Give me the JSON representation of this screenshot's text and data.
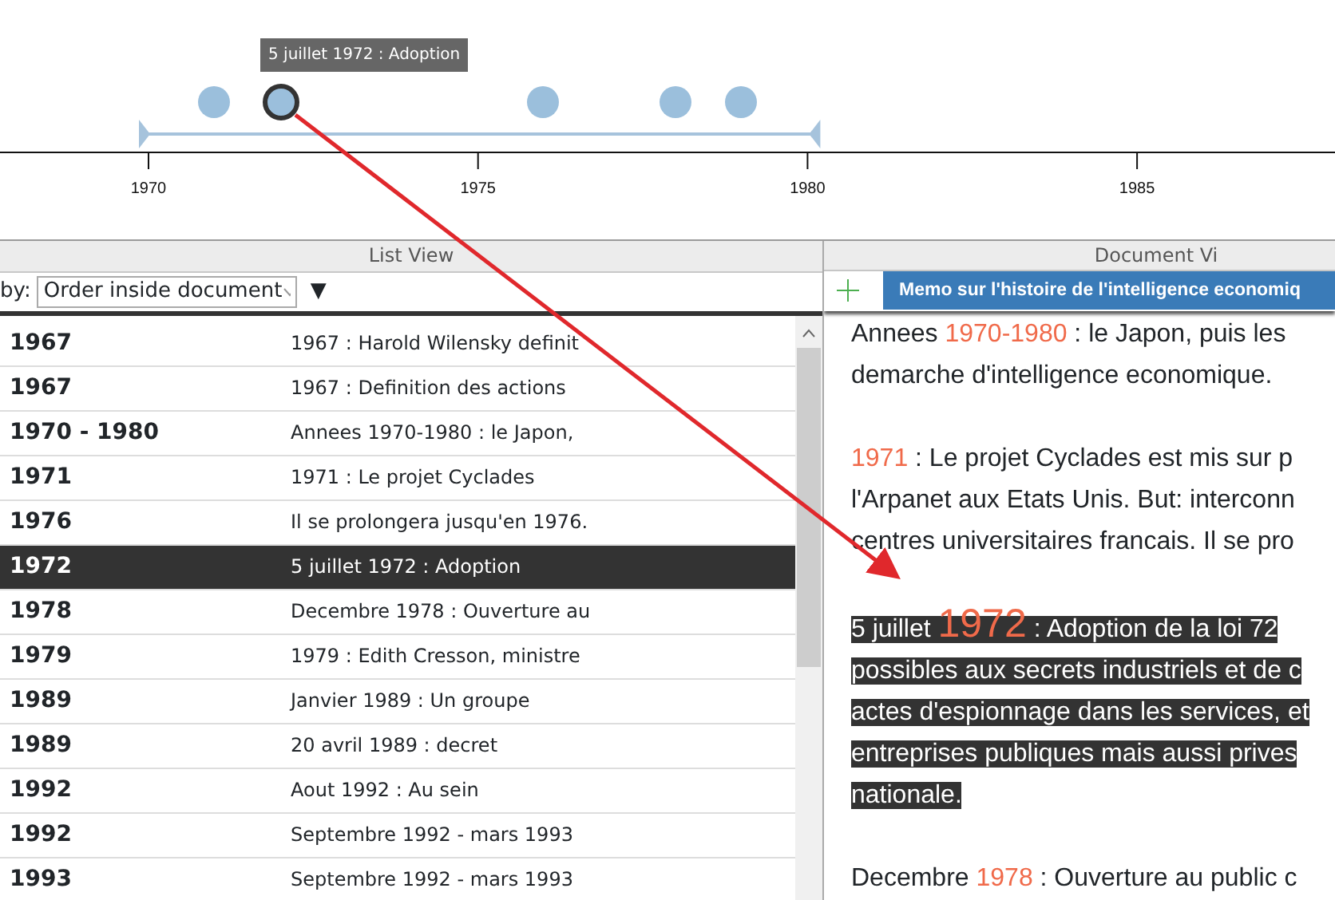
{
  "timeline": {
    "axis_labels": [
      "1970",
      "1975",
      "1980",
      "1985"
    ],
    "events": [
      {
        "selected": false
      },
      {
        "selected": true,
        "tooltip": "5 juillet 1972 : Adoption"
      },
      {
        "selected": false
      },
      {
        "selected": false
      },
      {
        "selected": false
      }
    ]
  },
  "list_view": {
    "title": "List View",
    "sort_label": "by:",
    "sort_value": "Order inside document",
    "sort_toggle": "▼",
    "rows": [
      {
        "year": "1967",
        "text": "1967 : Harold Wilensky definit",
        "selected": false
      },
      {
        "year": "1967",
        "text": "1967 : Definition des actions",
        "selected": false
      },
      {
        "year": "1970 - 1980",
        "text": "Annees 1970-1980 : le Japon,",
        "selected": false
      },
      {
        "year": "1971",
        "text": "1971 : Le projet Cyclades",
        "selected": false
      },
      {
        "year": "1976",
        "text": "Il se prolongera jusqu'en 1976.",
        "selected": false
      },
      {
        "year": "1972",
        "text": "5 juillet 1972 : Adoption",
        "selected": true
      },
      {
        "year": "1978",
        "text": "Decembre 1978 : Ouverture au",
        "selected": false
      },
      {
        "year": "1979",
        "text": "1979 : Edith Cresson, ministre",
        "selected": false
      },
      {
        "year": "1989",
        "text": "Janvier 1989 : Un groupe",
        "selected": false
      },
      {
        "year": "1989",
        "text": "20 avril 1989 : decret",
        "selected": false
      },
      {
        "year": "1992",
        "text": "Aout 1992 : Au sein",
        "selected": false
      },
      {
        "year": "1992",
        "text": "Septembre 1992 - mars 1993",
        "selected": false
      },
      {
        "year": "1993",
        "text": "Septembre 1992 - mars 1993",
        "selected": false
      }
    ]
  },
  "document_view": {
    "title": "Document Vi",
    "tab": "Memo sur l'histoire de l'intelligence economiq",
    "paragraphs": [
      {
        "selected": false,
        "lines": [
          [
            {
              "text": "Annees "
            },
            {
              "text": "1970-1980",
              "kind": "year"
            },
            {
              "text": " : le Japon, puis les"
            }
          ],
          [
            {
              "text": "demarche d'intelligence economique."
            }
          ]
        ]
      },
      {
        "selected": false,
        "lines": [
          [
            {
              "text": "1971",
              "kind": "year"
            },
            {
              "text": " : Le projet Cyclades est mis sur p"
            }
          ],
          [
            {
              "text": "l'Arpanet aux Etats Unis. But: interconn"
            }
          ],
          [
            {
              "text": "centres universitaires francais. Il se pro"
            }
          ]
        ]
      },
      {
        "selected": true,
        "lines": [
          [
            {
              "text": "5 juillet "
            },
            {
              "text": "1972",
              "kind": "year"
            },
            {
              "text": " : Adoption de la loi 72"
            }
          ],
          [
            {
              "text": "possibles aux secrets industriels et de c"
            }
          ],
          [
            {
              "text": "actes d'espionnage dans les services, et"
            }
          ],
          [
            {
              "text": "entreprises publiques mais aussi prives"
            }
          ],
          [
            {
              "text": "nationale."
            }
          ]
        ]
      },
      {
        "selected": false,
        "lines": [
          [
            {
              "text": "Decembre "
            },
            {
              "text": "1978",
              "kind": "year"
            },
            {
              "text": " : Ouverture au public c"
            }
          ]
        ]
      }
    ]
  }
}
